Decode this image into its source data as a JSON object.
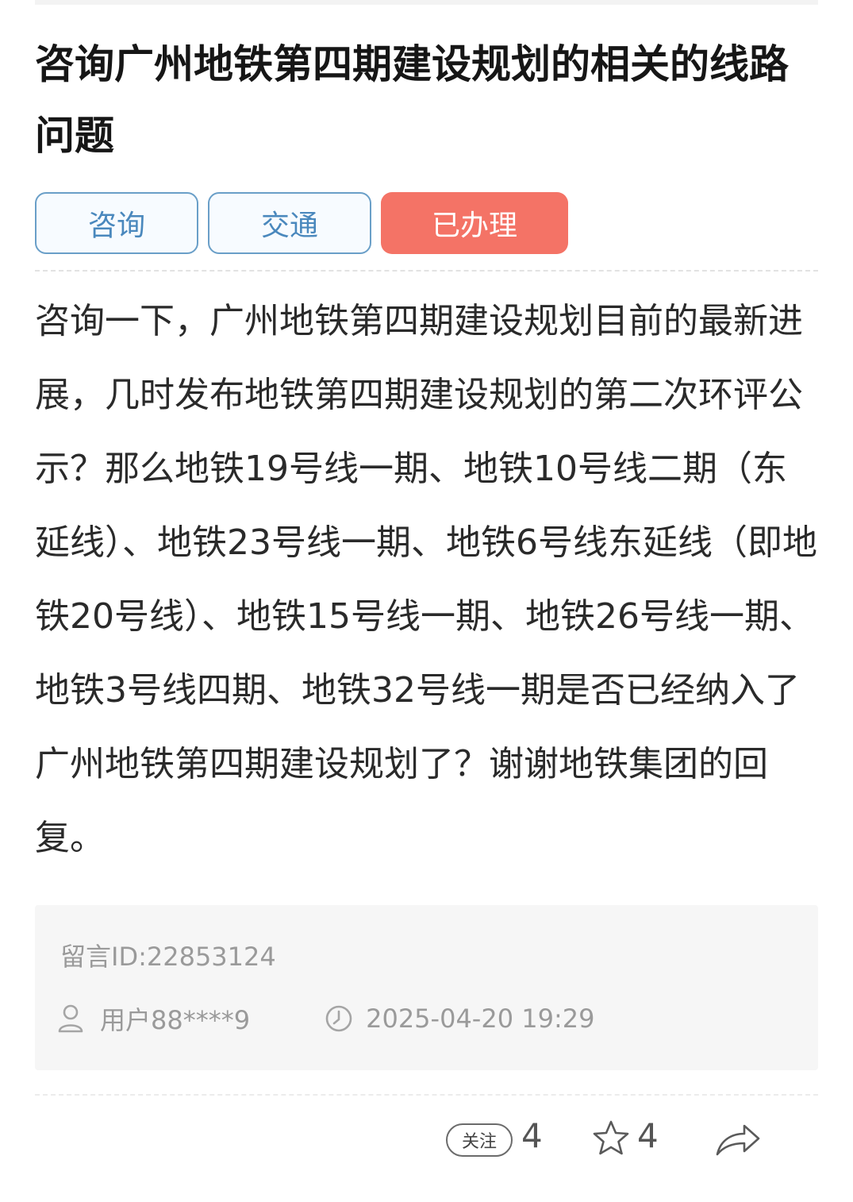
{
  "title": "咨询广州地铁第四期建设规划的相关的线路问题",
  "tags": [
    "咨询",
    "交通"
  ],
  "status": "已办理",
  "body": "咨询一下，广州地铁第四期建设规划目前的最新进展，几时发布地铁第四期建设规划的第二次环评公示？那么地铁19号线一期、地铁10号线二期（东延线）、地铁23号线一期、地铁6号线东延线（即地铁20号线）、地铁15号线一期、地铁26号线一期、地铁3号线四期、地铁32号线一期是否已经纳入了广州地铁第四期建设规划了？谢谢地铁集团的回复。",
  "meta": {
    "message_id": "留言ID:22853124",
    "user": "用户88****9",
    "datetime": "2025-04-20 19:29"
  },
  "actions": {
    "follow_label": "关注",
    "follow_count": "4",
    "favorite_count": "4"
  },
  "colors": {
    "tag_border": "#6a9fc8",
    "tag_text": "#4a88bd",
    "status_bg": "#f47366"
  },
  "icons": [
    "user-icon",
    "clock-icon",
    "star-icon",
    "share-icon"
  ]
}
